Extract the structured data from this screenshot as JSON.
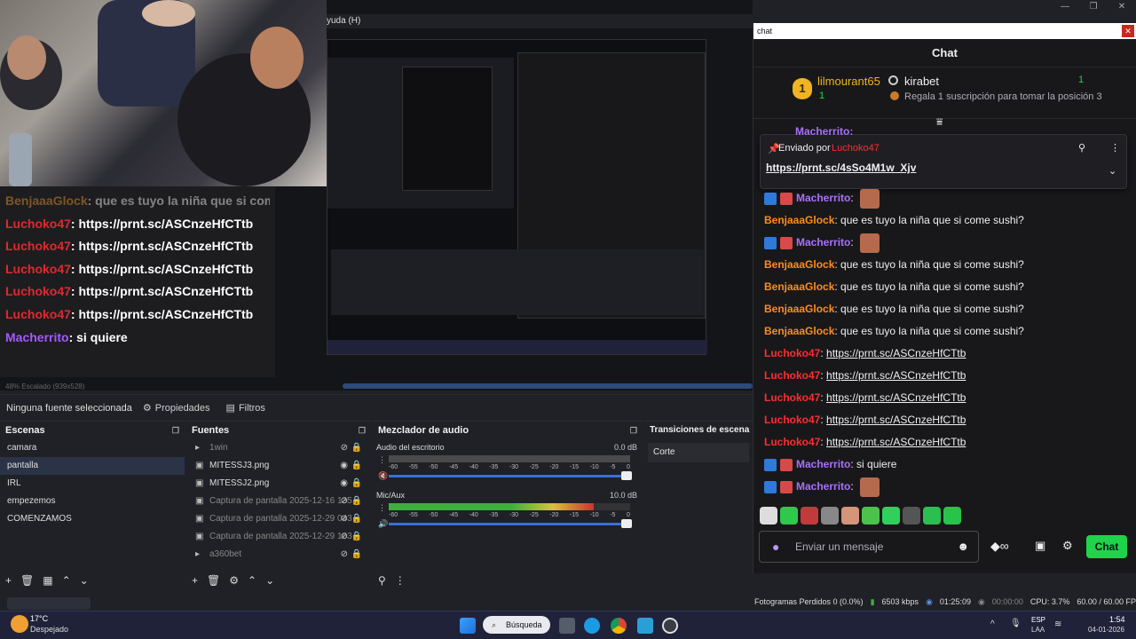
{
  "obs": {
    "menu_partial": "yuda (H)",
    "window_controls": [
      "—",
      "❐",
      "✕"
    ],
    "preview": {
      "scale_label": "48%  Escalado (939x528)",
      "stream_chat": [
        {
          "user": "BenjaaaGlock",
          "text": ": que es tuyo la niña que si come sushi?",
          "color": "orange",
          "faded": true
        },
        {
          "user": "Luchoko47",
          "text": ": https://prnt.sc/ASCnzeHfCTtb",
          "color": "red"
        },
        {
          "user": "Luchoko47",
          "text": ": https://prnt.sc/ASCnzeHfCTtb",
          "color": "red"
        },
        {
          "user": "Luchoko47",
          "text": ": https://prnt.sc/ASCnzeHfCTtb",
          "color": "red"
        },
        {
          "user": "Luchoko47",
          "text": ": https://prnt.sc/ASCnzeHfCTtb",
          "color": "red"
        },
        {
          "user": "Luchoko47",
          "text": ": https://prnt.sc/ASCnzeHfCTtb",
          "color": "red"
        },
        {
          "user": "Macherrito",
          "text": ": si quiere",
          "color": "purple"
        }
      ]
    },
    "context_bar": {
      "no_source": "Ninguna fuente seleccionada",
      "properties": "Propiedades",
      "filters": "Filtros"
    },
    "scenes": {
      "title": "Escenas",
      "items": [
        "camara",
        "pantalla",
        "IRL",
        "empezemos",
        "COMENZAMOS"
      ],
      "selected_index": 1
    },
    "sources": {
      "title": "Fuentes",
      "items": [
        {
          "name": "1win",
          "type": "folder",
          "dim": true
        },
        {
          "name": "MITESSJ3.png",
          "type": "image"
        },
        {
          "name": "MITESSJ2.png",
          "type": "image"
        },
        {
          "name": "Captura de pantalla 2025-12-16 135",
          "type": "image",
          "dim": true
        },
        {
          "name": "Captura de pantalla 2025-12-29 043",
          "type": "image",
          "dim": true
        },
        {
          "name": "Captura de pantalla 2025-12-29 103",
          "type": "image",
          "dim": true
        },
        {
          "name": "a360bet",
          "type": "folder",
          "dim": true
        }
      ]
    },
    "mixer": {
      "title": "Mezclador de audio",
      "channels": [
        {
          "name": "Audio del escritorio",
          "db": "0.0 dB",
          "level": 0.0,
          "muted": true
        },
        {
          "name": "Mic/Aux",
          "db": "10.0 dB",
          "level": 0.85,
          "muted": false
        }
      ],
      "ticks": [
        "-60",
        "-55",
        "-50",
        "-45",
        "-40",
        "-35",
        "-30",
        "-25",
        "-20",
        "-15",
        "-10",
        "-5",
        "0"
      ]
    },
    "transitions": {
      "title": "Transiciones de escena",
      "selected": "Corte"
    },
    "status": {
      "dropped_frames": "Fotogramas Perdidos 0 (0.0%)",
      "bitrate": "6503 kbps",
      "live_time": "01:25:09",
      "rec_time": "00:00:00",
      "cpu": "CPU: 3.7%",
      "fps": "60.00 / 60.00 FPS"
    }
  },
  "chat_window": {
    "title": "chat",
    "header": "Chat",
    "leaderboard": {
      "rank1_user": "lilmourant65",
      "rank1_count": "1",
      "rank2_user": "kirabet",
      "rank2_count": "1",
      "gift_prompt": "Regala 1 suscripción para tomar la posición 3"
    },
    "pinned": {
      "sent_by_label": "Enviado por",
      "sent_by_user": "Luchoko47",
      "link": "https://prnt.sc/4sSo4M1w_Xjv",
      "peek_user": "Macherrito:"
    },
    "messages": [
      {
        "user": "Macherrito",
        "text": "",
        "color": "#a970ff",
        "emote": true
      },
      {
        "user": "BenjaaaGlock",
        "text": "que es tuyo la niña que si come sushi?",
        "color": "#ff8c1a"
      },
      {
        "user": "Macherrito",
        "text": "",
        "color": "#a970ff",
        "emote": true
      },
      {
        "user": "BenjaaaGlock",
        "text": "que es tuyo la niña que si come sushi?",
        "color": "#ff8c1a"
      },
      {
        "user": "BenjaaaGlock",
        "text": "que es tuyo la niña que si come sushi?",
        "color": "#ff8c1a"
      },
      {
        "user": "BenjaaaGlock",
        "text": "que es tuyo la niña que si come sushi?",
        "color": "#ff8c1a"
      },
      {
        "user": "BenjaaaGlock",
        "text": "que es tuyo la niña que si come sushi?",
        "color": "#ff8c1a"
      },
      {
        "user": "Luchoko47",
        "text": "https://prnt.sc/ASCnzeHfCTtb",
        "color": "#ff2d2d",
        "link": true
      },
      {
        "user": "Luchoko47",
        "text": "https://prnt.sc/ASCnzeHfCTtb",
        "color": "#ff2d2d",
        "link": true
      },
      {
        "user": "Luchoko47",
        "text": "https://prnt.sc/ASCnzeHfCTtb",
        "color": "#ff2d2d",
        "link": true
      },
      {
        "user": "Luchoko47",
        "text": "https://prnt.sc/ASCnzeHfCTtb",
        "color": "#ff2d2d",
        "link": true
      },
      {
        "user": "Luchoko47",
        "text": "https://prnt.sc/ASCnzeHfCTtb",
        "color": "#ff2d2d",
        "link": true
      },
      {
        "user": "Macherrito",
        "text": "si quiere",
        "color": "#a970ff"
      },
      {
        "user": "Macherrito",
        "text": "",
        "color": "#a970ff",
        "emote": true
      }
    ],
    "input_placeholder": "Enviar un mensaje",
    "send_label": "Chat"
  },
  "taskbar": {
    "weather_temp": "17°C",
    "weather_desc": "Despejado",
    "search_label": "Búsqueda",
    "lang": "ESP",
    "lang_sub": "LAA",
    "time": "1:54",
    "date": "04-01-2026"
  },
  "colors": {
    "accent_green": "#1fd34a",
    "username_red": "#ff2d2d",
    "username_purple": "#a970ff",
    "username_orange": "#ff8c1a",
    "obs_bg": "#1f2126"
  }
}
